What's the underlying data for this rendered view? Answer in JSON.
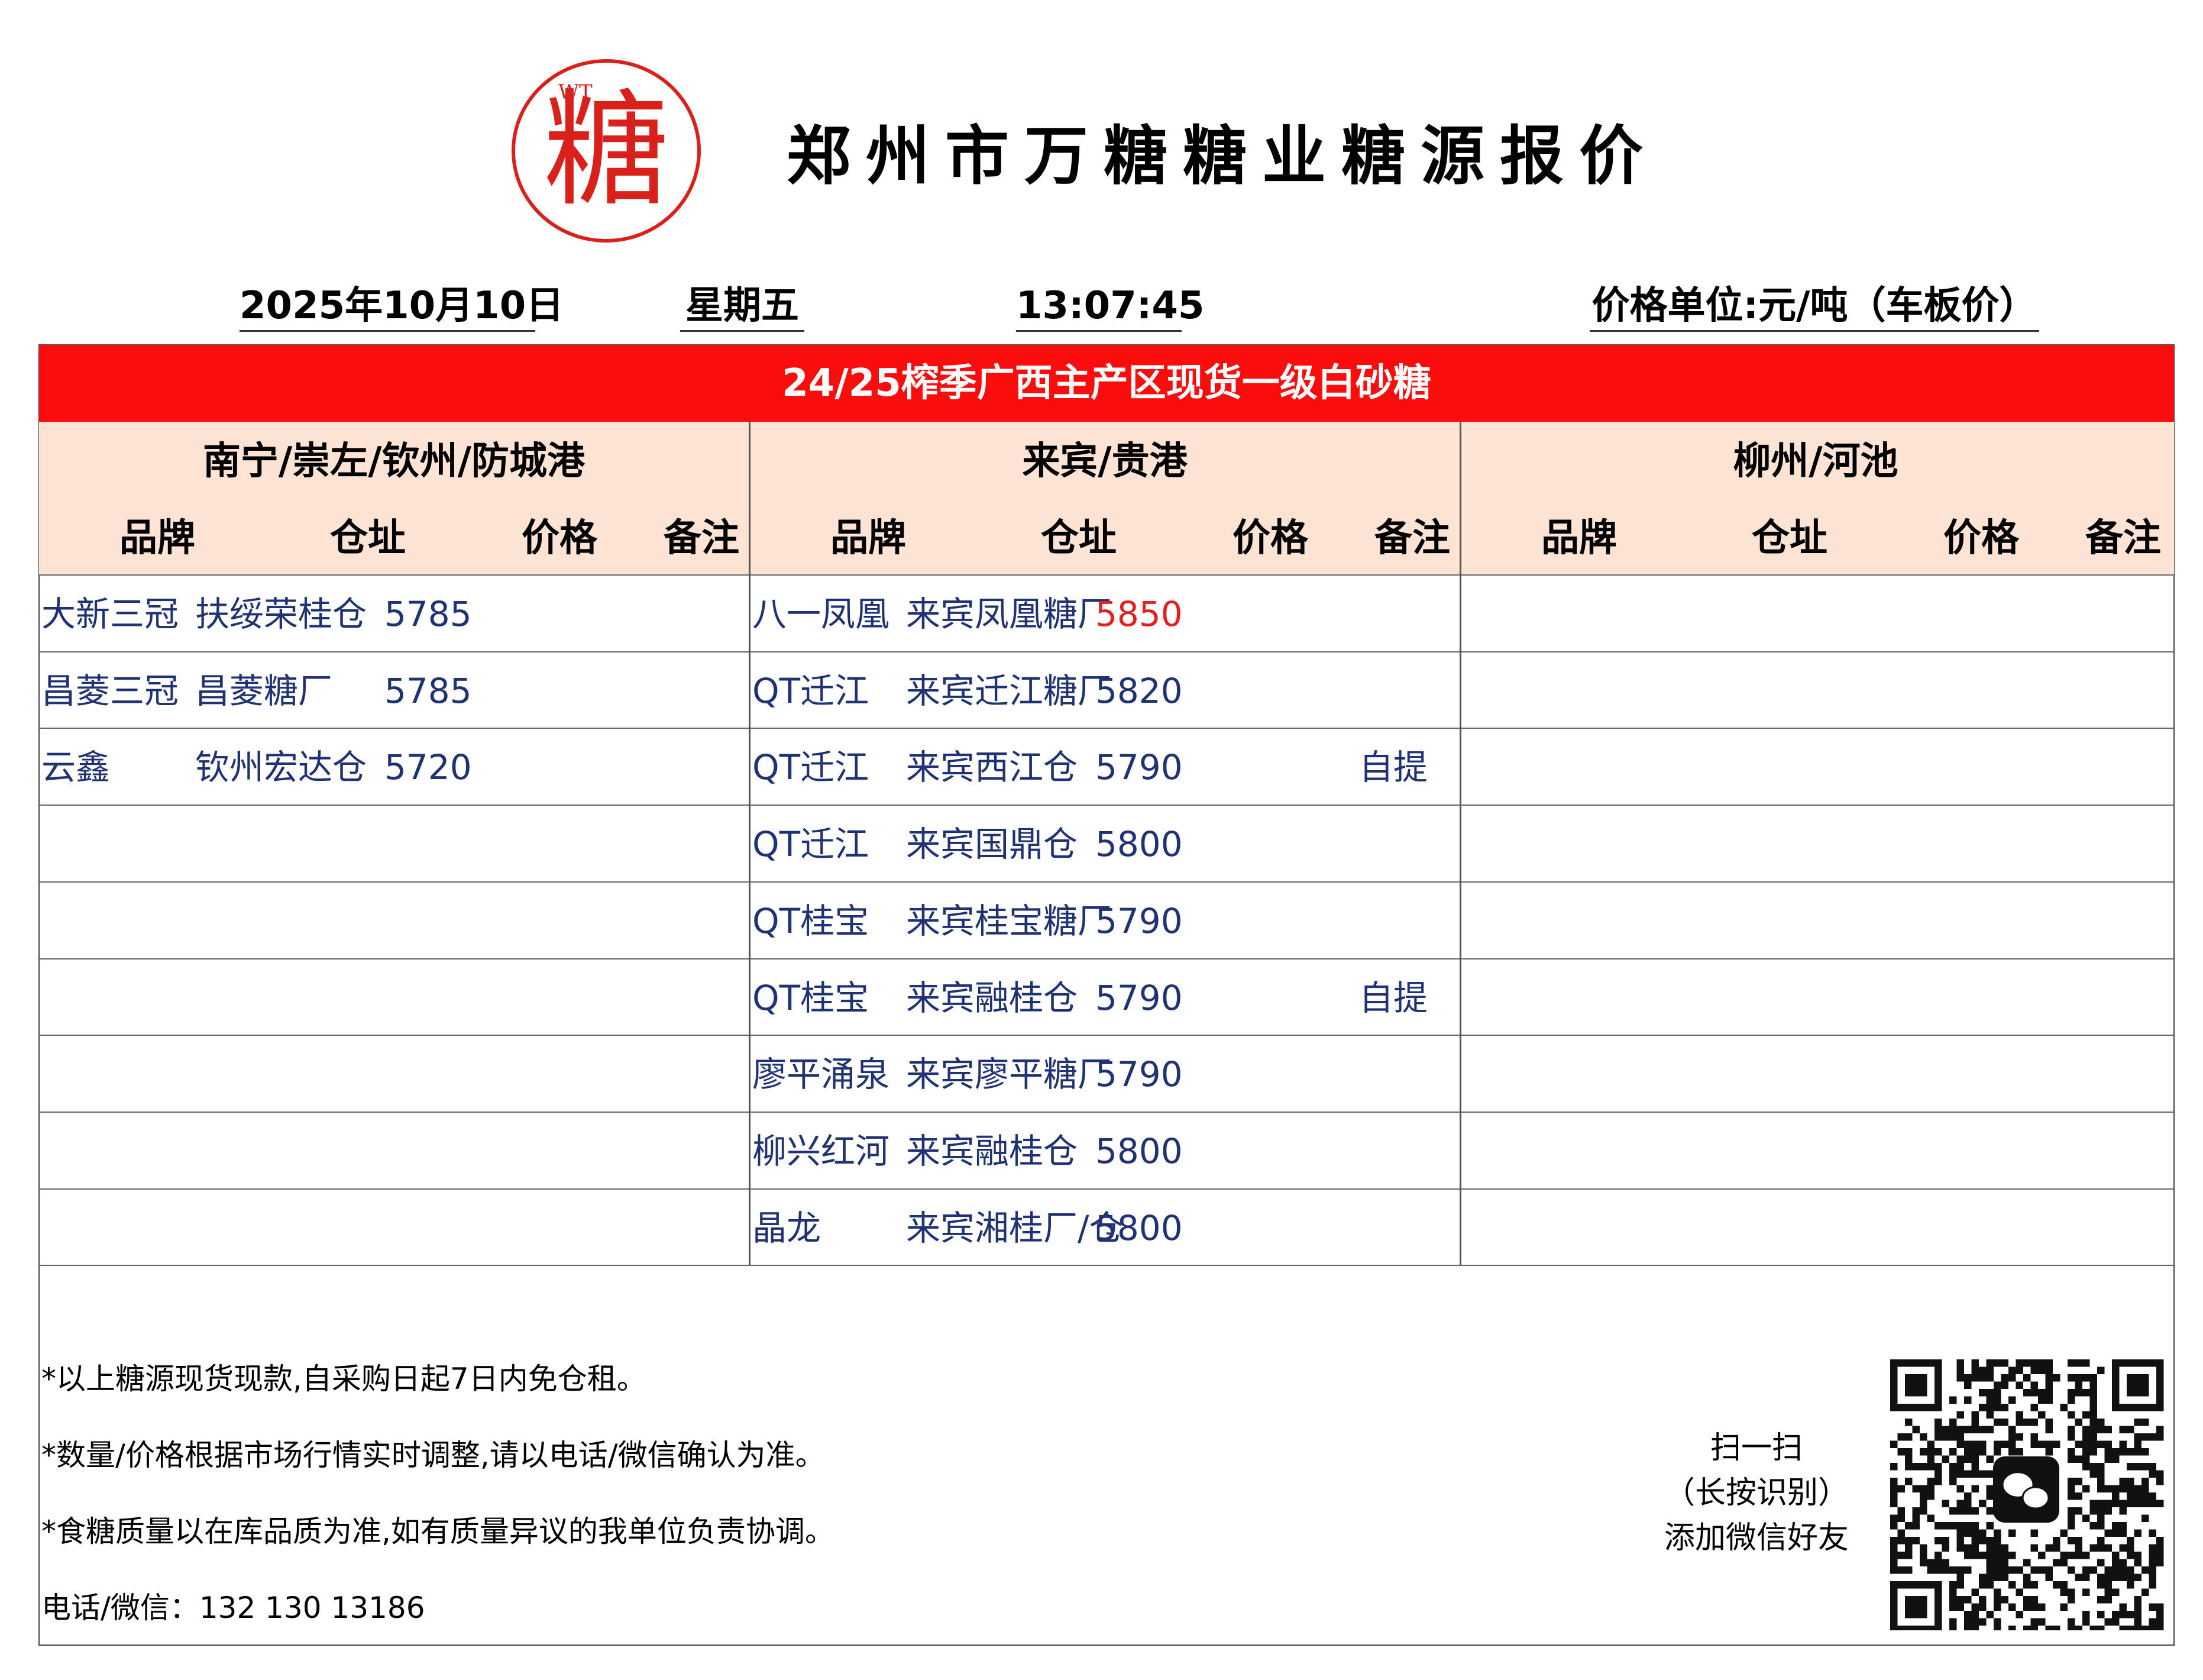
{
  "header": {
    "logo_wt": "WT",
    "logo_char": "糖",
    "title": "郑州市万糖糖业糖源报价",
    "date": "2025年10月10日",
    "weekday": "星期五",
    "time": "13:07:45",
    "unit": "价格单位:元/吨（车板价）"
  },
  "banner": "24/25榨季广西主产区现货一级白砂糖",
  "columns": [
    "品牌",
    "仓址",
    "价格",
    "备注"
  ],
  "regions": [
    {
      "name": "南宁/崇左/钦州/防城港",
      "rows": [
        {
          "brand": "大新三冠",
          "location": "扶绥荣桂仓",
          "price": "5785",
          "remark": ""
        },
        {
          "brand": "昌菱三冠",
          "location": "昌菱糖厂",
          "price": "5785",
          "remark": ""
        },
        {
          "brand": "云鑫",
          "location": "钦州宏达仓",
          "price": "5720",
          "remark": ""
        }
      ]
    },
    {
      "name": "来宾/贵港",
      "rows": [
        {
          "brand": "八一凤凰",
          "location": "来宾凤凰糖厂",
          "price": "5850",
          "remark": ""
        },
        {
          "brand": "QT迁江",
          "location": "来宾迁江糖厂",
          "price": "5820",
          "remark": ""
        },
        {
          "brand": "QT迁江",
          "location": "来宾西江仓",
          "price": "5790",
          "remark": "自提"
        },
        {
          "brand": "QT迁江",
          "location": "来宾国鼎仓",
          "price": "5800",
          "remark": ""
        },
        {
          "brand": "QT桂宝",
          "location": "来宾桂宝糖厂",
          "price": "5790",
          "remark": ""
        },
        {
          "brand": "QT桂宝",
          "location": "来宾融桂仓",
          "price": "5790",
          "remark": "自提"
        },
        {
          "brand": "廖平涌泉",
          "location": "来宾廖平糖厂",
          "price": "5790",
          "remark": ""
        },
        {
          "brand": "柳兴红河",
          "location": "来宾融桂仓",
          "price": "5800",
          "remark": ""
        },
        {
          "brand": "晶龙",
          "location": "来宾湘桂厂/仓",
          "price": "5800",
          "remark": ""
        }
      ]
    },
    {
      "name": "柳州/河池",
      "rows": []
    }
  ],
  "colors": {
    "banner": "#fc0d0d",
    "header_band": "#fde3d4",
    "cell_text": "#1f3374",
    "highlight_price": "#e41f1f",
    "logo": "#d9201a"
  },
  "footer": {
    "notes": [
      "*以上糖源现货现款,自采购日起7日内免仓租。",
      "*数量/价格根据市场行情实时调整,请以电话/微信确认为准。",
      "*食糖质量以在库品质为准,如有质量异议的我单位负责协调。"
    ],
    "contact": "电话/微信：132 130 13186",
    "scan_lines": [
      "扫一扫",
      "（长按识别）",
      "添加微信好友"
    ]
  }
}
